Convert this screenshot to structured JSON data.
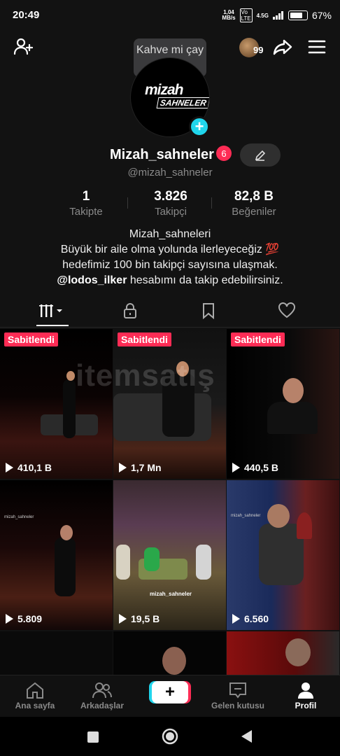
{
  "status_bar": {
    "time": "20:49",
    "net_speed_top": "1,04",
    "net_speed_bottom": "MB/s",
    "signal_label": "4.5G",
    "battery_pct": "67%"
  },
  "header": {
    "tooltip": "Kahve mi çay mı?",
    "friends_count": "99",
    "icons": [
      "add-friend-icon",
      "share-icon",
      "menu-icon"
    ]
  },
  "avatar": {
    "logo_top": "mizah",
    "logo_bottom": "SAHNELER"
  },
  "profile": {
    "display_name": "Mizah_sahneler",
    "badge_count": "6",
    "username": "@mizah_sahneler"
  },
  "stats": [
    {
      "value": "1",
      "label": "Takipte"
    },
    {
      "value": "3.826",
      "label": "Takipçi"
    },
    {
      "value": "82,8 B",
      "label": "Beğeniler"
    }
  ],
  "bio": {
    "line1": "Mizah_sahneleri",
    "line2": "Büyük bir aile olma yolunda ilerleyeceğiz 💯",
    "line3": "hedefimiz 100 bin takipçi sayısına ulaşmak.",
    "mention": "@lodos_ilker",
    "line4_rest": " hesabımı da takip edebilirsiniz."
  },
  "watermark": "itemsatış",
  "videos": [
    {
      "pinned": "Sabitlendi",
      "views": "410,1 B",
      "logo": ""
    },
    {
      "pinned": "Sabitlendi",
      "views": "1,7 Mn",
      "logo": ""
    },
    {
      "pinned": "Sabitlendi",
      "views": "440,5 B",
      "logo": ""
    },
    {
      "pinned": "",
      "views": "5.809",
      "logo": "mizah_sahneler"
    },
    {
      "pinned": "",
      "views": "19,5 B",
      "logo": "mizah_sahneler"
    },
    {
      "pinned": "",
      "views": "6.560",
      "logo": "mizah_sahneler"
    }
  ],
  "bottom_nav": [
    {
      "label": "Ana sayfa"
    },
    {
      "label": "Arkadaşlar"
    },
    {
      "label": "+"
    },
    {
      "label": "Gelen kutusu"
    },
    {
      "label": "Profil"
    }
  ],
  "colors": {
    "accent_pink": "#fe2c55",
    "accent_cyan": "#20d5ec",
    "background": "#121212"
  }
}
